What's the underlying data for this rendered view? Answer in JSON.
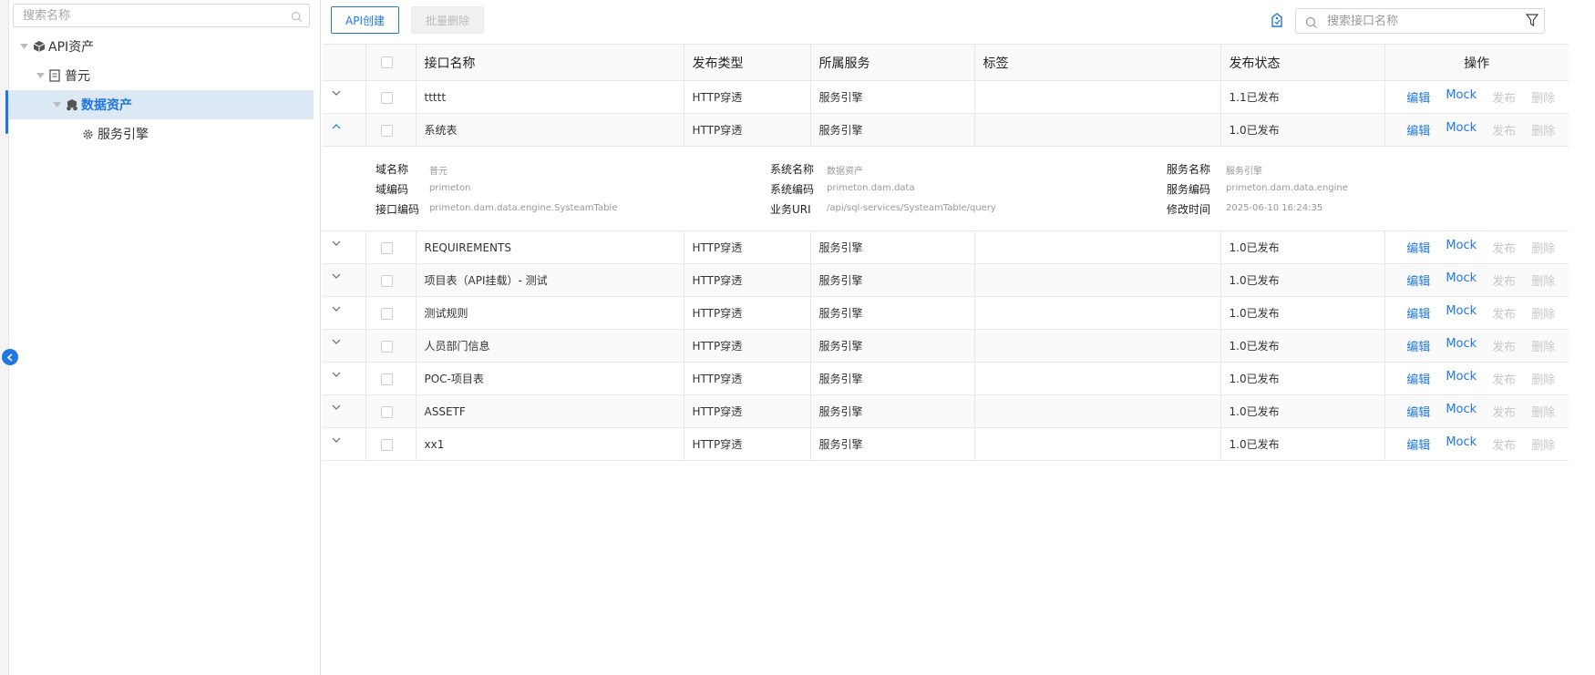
{
  "sidebar": {
    "search_placeholder": "搜索名称",
    "tree": [
      {
        "label": "API资产"
      },
      {
        "label": "普元"
      },
      {
        "label": "数据资产"
      },
      {
        "label": "服务引擎"
      }
    ]
  },
  "toolbar": {
    "create_label": "API创建",
    "batch_delete_label": "批量删除",
    "search_placeholder": "搜索接口名称"
  },
  "table": {
    "columns": [
      "接口名称",
      "发布类型",
      "所属服务",
      "标签",
      "发布状态",
      "操作"
    ],
    "actions": {
      "edit": "编辑",
      "mock": "Mock",
      "publish": "发布",
      "delete": "删除"
    },
    "rows": [
      {
        "name": "ttttt",
        "type": "HTTP穿透",
        "service": "服务引擎",
        "tag": "",
        "status": "1.1已发布"
      },
      {
        "name": "系统表",
        "type": "HTTP穿透",
        "service": "服务引擎",
        "tag": "",
        "status": "1.0已发布"
      },
      {
        "name": "REQUIREMENTS",
        "type": "HTTP穿透",
        "service": "服务引擎",
        "tag": "",
        "status": "1.0已发布"
      },
      {
        "name": "项目表（API挂载）- 测试",
        "type": "HTTP穿透",
        "service": "服务引擎",
        "tag": "",
        "status": "1.0已发布"
      },
      {
        "name": "测试规则",
        "type": "HTTP穿透",
        "service": "服务引擎",
        "tag": "",
        "status": "1.0已发布"
      },
      {
        "name": "人员部门信息",
        "type": "HTTP穿透",
        "service": "服务引擎",
        "tag": "",
        "status": "1.0已发布"
      },
      {
        "name": "POC-项目表",
        "type": "HTTP穿透",
        "service": "服务引擎",
        "tag": "",
        "status": "1.0已发布"
      },
      {
        "name": "ASSETF",
        "type": "HTTP穿透",
        "service": "服务引擎",
        "tag": "",
        "status": "1.0已发布"
      },
      {
        "name": "xx1",
        "type": "HTTP穿透",
        "service": "服务引擎",
        "tag": "",
        "status": "1.0已发布"
      }
    ],
    "detail": {
      "domain_name_label": "域名称",
      "domain_name": "普元",
      "domain_code_label": "域编码",
      "domain_code": "primeton",
      "api_code_label": "接口编码",
      "api_code": "primeton.dam.data.engine.SysteamTable",
      "system_name_label": "系统名称",
      "system_name": "数据资产",
      "system_code_label": "系统编码",
      "system_code": "primeton.dam.data",
      "uri_label": "业务URI",
      "uri": "/api/sql-services/SysteamTable/query",
      "service_name_label": "服务名称",
      "service_name": "服务引擎",
      "service_code_label": "服务编码",
      "service_code": "primeton.dam.data.engine",
      "modified_label": "修改时间",
      "modified": "2025-06-10 16:24:35"
    }
  },
  "colors": {
    "accent": "#1f78e0",
    "disabled": "#c8c8c8",
    "selected_bg": "#dde8f5"
  }
}
